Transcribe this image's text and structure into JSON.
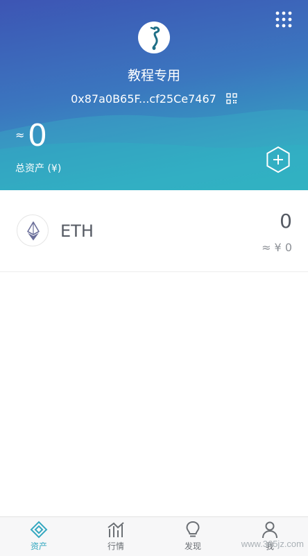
{
  "wallet": {
    "name": "教程专用",
    "address": "0x87a0B65F...cf25Ce7467",
    "approx_sign": "≈",
    "total_value": "0",
    "total_label": "总资产 (¥)"
  },
  "assets": [
    {
      "symbol": "ETH",
      "amount": "0",
      "fiat": "≈ ¥ 0",
      "icon": "ethereum-icon"
    }
  ],
  "tabbar": [
    {
      "label": "资产",
      "icon": "assets-diamond-icon",
      "active": true
    },
    {
      "label": "行情",
      "icon": "market-chart-icon",
      "active": false
    },
    {
      "label": "发现",
      "icon": "lightbulb-icon",
      "active": false
    },
    {
      "label": "我",
      "icon": "person-icon",
      "active": false
    }
  ],
  "watermark": "www.365jz.com",
  "colors": {
    "header_top": "#3d55b4",
    "header_bottom": "#31b0c1",
    "accent": "#35a8c0",
    "text_dark": "#555a63"
  }
}
